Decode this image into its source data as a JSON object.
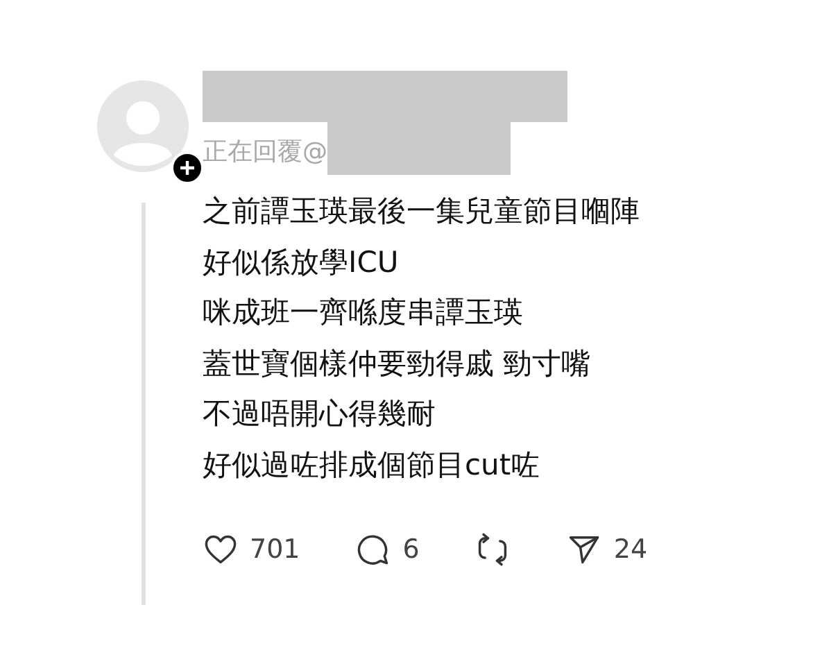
{
  "post": {
    "reply_prefix": "正在回覆@",
    "lines": [
      "之前譚玉瑛最後一集兒童節目嗰陣",
      "好似係放學ICU",
      "咪成班一齊喺度串譚玉瑛",
      "蓋世寶個樣仲要勁得戚 勁寸嘴",
      "不過唔開心得幾耐",
      "好似過咗排成個節目cut咗"
    ],
    "actions": [
      {
        "kind": "like",
        "count": "701"
      },
      {
        "kind": "comment",
        "count": "6"
      },
      {
        "kind": "repost"
      },
      {
        "kind": "share",
        "count": "24"
      }
    ]
  }
}
